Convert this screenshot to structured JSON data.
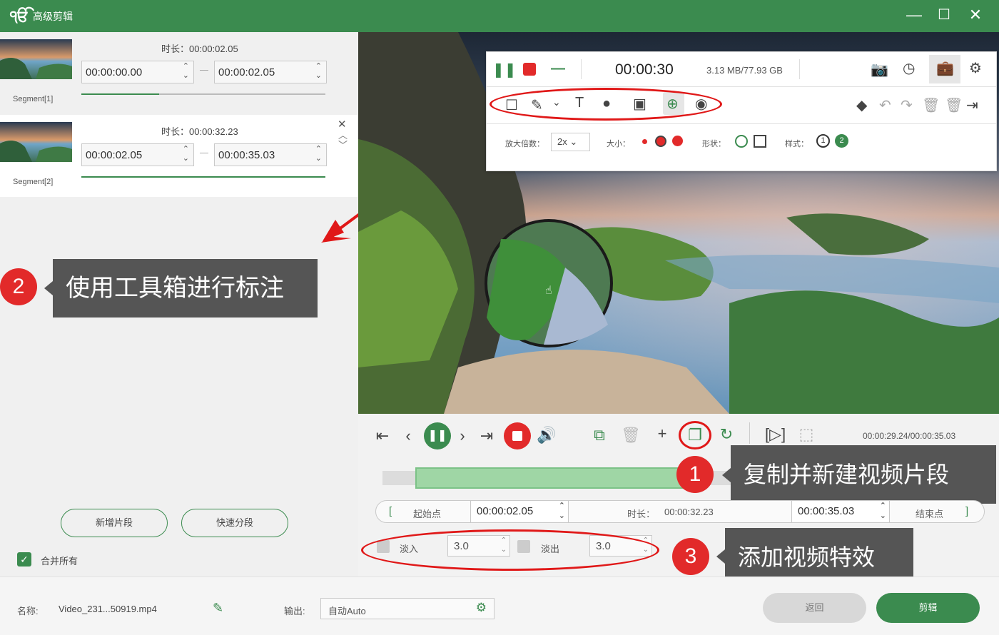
{
  "window": {
    "title": "高级剪辑",
    "logo": "ੴ",
    "min": "—",
    "max": "☐",
    "close": "✕"
  },
  "segments": [
    {
      "name": "Segment[1]",
      "duration_label": "时长：",
      "duration": "00:00:02.05",
      "start": "00:00:00.00",
      "end": "00:00:02.05",
      "progress": 0.32
    },
    {
      "name": "Segment[2]",
      "duration_label": "时长：",
      "duration": "00:00:32.23",
      "start": "00:00:02.05",
      "end": "00:00:35.03",
      "progress": 1.0
    }
  ],
  "left": {
    "new_segment": "新增片段",
    "quick_split": "快速分段",
    "merge_all": "合并所有",
    "merge_checked": true
  },
  "callouts": {
    "c1": {
      "num": "1",
      "text": "复制并新建视频片段"
    },
    "c2": {
      "num": "2",
      "text": "使用工具箱进行标注"
    },
    "c3": {
      "num": "3",
      "text": "添加视频特效"
    }
  },
  "toolbar": {
    "rec_time": "00:00:30",
    "storage": "3.13 MB/77.93 GB",
    "zoom_label": "放大倍数：",
    "zoom_value": "2x",
    "size_label": "大小：",
    "shape_label": "形状：",
    "style_label": "样式：",
    "style1": "1",
    "style2": "2"
  },
  "timeline": {
    "time_readout": "00:00:29.24/00:00:35.03",
    "progress": 0.45
  },
  "trim": {
    "start_label": "起始点",
    "start": "00:00:02.05",
    "duration_label": "时长：",
    "duration": "00:00:32.23",
    "end": "00:00:35.03",
    "end_label": "结束点",
    "open_bracket": "[",
    "close_bracket": "]"
  },
  "effects": {
    "fadein_label": "淡入",
    "fadein": "3.0",
    "fadeout_label": "淡出",
    "fadeout": "3.0"
  },
  "bottom": {
    "name_label": "名称:",
    "filename": "Video_231...50919.mp4",
    "output_label": "输出:",
    "output_value": "自动Auto",
    "back": "返回",
    "cut": "剪辑"
  },
  "colors": {
    "brand": "#3b8b4f",
    "accent_red": "#e01818",
    "callout_bg": "#555555"
  }
}
